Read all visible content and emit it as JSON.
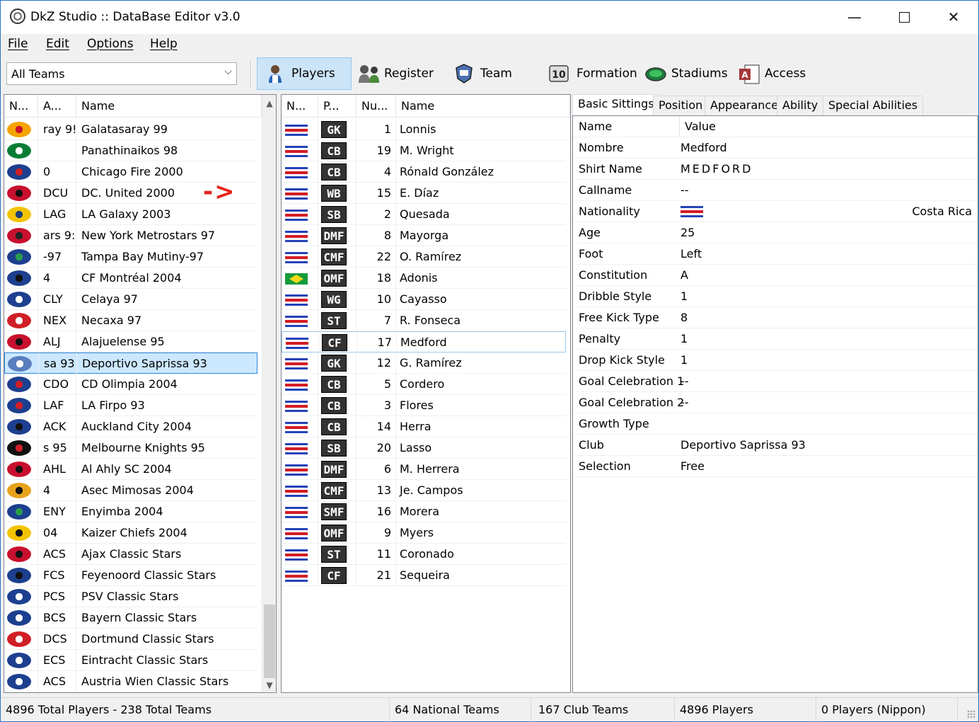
{
  "window": {
    "title": "DkZ Studio :: DataBase Editor v3.0"
  },
  "menu": [
    "File",
    "Edit",
    "Options",
    "Help"
  ],
  "toolbar": {
    "team_filter": "All Teams",
    "buttons": [
      {
        "label": "Players",
        "icon": "player-icon",
        "active": true
      },
      {
        "label": "Register",
        "icon": "register-icon",
        "active": false
      },
      {
        "label": "Team",
        "icon": "team-icon",
        "active": false
      },
      {
        "label": "Formation",
        "icon": "formation-icon",
        "active": false
      },
      {
        "label": "Stadiums",
        "icon": "stadium-icon",
        "active": false
      },
      {
        "label": "Access",
        "icon": "access-icon",
        "active": false
      }
    ]
  },
  "teams": {
    "columns": [
      "N...",
      "A...",
      "Name"
    ],
    "rows": [
      {
        "abbr": "ray 9!",
        "name": "Galatasaray 99",
        "colors": [
          "#f5a300",
          "#c8102e"
        ]
      },
      {
        "abbr": "",
        "name": "Panathinaikos 98",
        "colors": [
          "#0a7d35",
          "#ffffff"
        ]
      },
      {
        "abbr": "0",
        "name": "Chicago Fire 2000",
        "colors": [
          "#1d3f8f",
          "#d01f26"
        ]
      },
      {
        "abbr": "DCU",
        "name": "DC. United 2000",
        "colors": [
          "#c8102e",
          "#111111"
        ]
      },
      {
        "abbr": "LAG",
        "name": "LA Galaxy 2003",
        "colors": [
          "#f3c300",
          "#1a3d7c"
        ]
      },
      {
        "abbr": "ars 9:",
        "name": "New York Metrostars 97",
        "colors": [
          "#c8102e",
          "#222222"
        ]
      },
      {
        "abbr": "-97",
        "name": "Tampa Bay Mutiny-97",
        "colors": [
          "#1d3f8f",
          "#2a9d4c"
        ]
      },
      {
        "abbr": "4",
        "name": "CF Montréal 2004",
        "colors": [
          "#1d3f8f",
          "#111111"
        ]
      },
      {
        "abbr": "CLY",
        "name": "Celaya 97",
        "colors": [
          "#1d3f8f",
          "#ffffff"
        ]
      },
      {
        "abbr": "NEX",
        "name": "Necaxa 97",
        "colors": [
          "#d01f26",
          "#ffffff"
        ]
      },
      {
        "abbr": "ALJ",
        "name": "Alajuelense 95",
        "colors": [
          "#c8102e",
          "#111111"
        ]
      },
      {
        "abbr": "sa 93",
        "name": "Deportivo Saprissa 93",
        "colors": [
          "#5a7fbf",
          "#ffffff"
        ]
      },
      {
        "abbr": "CDO",
        "name": "CD Olimpia 2004",
        "colors": [
          "#1d3f8f",
          "#d01f26"
        ]
      },
      {
        "abbr": "LAF",
        "name": "LA Firpo 93",
        "colors": [
          "#1d3f8f",
          "#d01f26"
        ]
      },
      {
        "abbr": "ACK",
        "name": "Auckland City 2004",
        "colors": [
          "#1d3f8f",
          "#111111"
        ]
      },
      {
        "abbr": "s 95",
        "name": "Melbourne Knights 95",
        "colors": [
          "#111111",
          "#d01f26"
        ]
      },
      {
        "abbr": "AHL",
        "name": "Al Ahly SC 2004",
        "colors": [
          "#c8102e",
          "#111111"
        ]
      },
      {
        "abbr": "4",
        "name": "Asec Mimosas 2004",
        "colors": [
          "#e7a21b",
          "#111111"
        ]
      },
      {
        "abbr": "ENY",
        "name": "Enyimba 2004",
        "colors": [
          "#1d3f8f",
          "#2a9d4c"
        ]
      },
      {
        "abbr": "04",
        "name": "Kaizer Chiefs 2004",
        "colors": [
          "#f3c300",
          "#111111"
        ]
      },
      {
        "abbr": "ACS",
        "name": "Ajax Classic Stars",
        "colors": [
          "#c8102e",
          "#111111"
        ]
      },
      {
        "abbr": "FCS",
        "name": "Feyenoord Classic Stars",
        "colors": [
          "#1d3f8f",
          "#111111"
        ]
      },
      {
        "abbr": "PCS",
        "name": "PSV Classic Stars",
        "colors": [
          "#1d3f8f",
          "#ffffff"
        ]
      },
      {
        "abbr": "BCS",
        "name": "Bayern Classic Stars",
        "colors": [
          "#1d3f8f",
          "#ffffff"
        ]
      },
      {
        "abbr": "DCS",
        "name": "Dortmund Classic Stars",
        "colors": [
          "#d01f26",
          "#ffffff"
        ]
      },
      {
        "abbr": "ECS",
        "name": "Eintracht Classic Stars",
        "colors": [
          "#1d3f8f",
          "#ffffff"
        ]
      },
      {
        "abbr": "ACS",
        "name": "Austria Wien Classic Stars",
        "colors": [
          "#1d3f8f",
          "#ffffff"
        ]
      }
    ],
    "selected_index": 11
  },
  "players": {
    "columns": [
      "N...",
      "P...",
      "Nu...",
      "Name"
    ],
    "rows": [
      {
        "flag": "cr",
        "pos": "GK",
        "num": "1",
        "name": "Lonnis"
      },
      {
        "flag": "cr",
        "pos": "CB",
        "num": "19",
        "name": "M. Wright"
      },
      {
        "flag": "cr",
        "pos": "CB",
        "num": "4",
        "name": "Rónald González"
      },
      {
        "flag": "cr",
        "pos": "WB",
        "num": "15",
        "name": "E. Díaz"
      },
      {
        "flag": "cr",
        "pos": "SB",
        "num": "2",
        "name": "Quesada"
      },
      {
        "flag": "cr",
        "pos": "DMF",
        "num": "8",
        "name": "Mayorga"
      },
      {
        "flag": "cr",
        "pos": "CMF",
        "num": "22",
        "name": "O. Ramírez"
      },
      {
        "flag": "br",
        "pos": "OMF",
        "num": "18",
        "name": "Adonis"
      },
      {
        "flag": "cr",
        "pos": "WG",
        "num": "10",
        "name": "Cayasso"
      },
      {
        "flag": "cr",
        "pos": "ST",
        "num": "7",
        "name": "R. Fonseca"
      },
      {
        "flag": "cr",
        "pos": "CF",
        "num": "17",
        "name": "Medford"
      },
      {
        "flag": "cr",
        "pos": "GK",
        "num": "12",
        "name": "G. Ramírez"
      },
      {
        "flag": "cr",
        "pos": "CB",
        "num": "5",
        "name": "Cordero"
      },
      {
        "flag": "cr",
        "pos": "CB",
        "num": "3",
        "name": "Flores"
      },
      {
        "flag": "cr",
        "pos": "CB",
        "num": "14",
        "name": "Herra"
      },
      {
        "flag": "cr",
        "pos": "SB",
        "num": "20",
        "name": "Lasso"
      },
      {
        "flag": "cr",
        "pos": "DMF",
        "num": "6",
        "name": "M. Herrera"
      },
      {
        "flag": "cr",
        "pos": "CMF",
        "num": "13",
        "name": "Je. Campos"
      },
      {
        "flag": "cr",
        "pos": "SMF",
        "num": "16",
        "name": "Morera"
      },
      {
        "flag": "cr",
        "pos": "OMF",
        "num": "9",
        "name": "Myers"
      },
      {
        "flag": "cr",
        "pos": "ST",
        "num": "11",
        "name": "Coronado"
      },
      {
        "flag": "cr",
        "pos": "CF",
        "num": "21",
        "name": "Sequeira"
      }
    ],
    "focused_index": 10
  },
  "details": {
    "tabs": [
      "Basic Sittings",
      "Position",
      "Appearance",
      "Ability",
      "Special Abilities"
    ],
    "header": {
      "name": "Name",
      "value": "Value"
    },
    "props": [
      {
        "name": "Nombre",
        "value": "Medford"
      },
      {
        "name": "Shirt Name",
        "value": "MEDFORD"
      },
      {
        "name": "Callname",
        "value": "--"
      },
      {
        "name": "Nationality",
        "value": "Costa Rica",
        "flag": "cr"
      },
      {
        "name": "Age",
        "value": "25"
      },
      {
        "name": "Foot",
        "value": "Left"
      },
      {
        "name": "Constitution",
        "value": "A"
      },
      {
        "name": "Dribble Style",
        "value": "1"
      },
      {
        "name": "Free Kick Type",
        "value": "8"
      },
      {
        "name": "Penalty",
        "value": "1"
      },
      {
        "name": "Drop Kick Style",
        "value": "1"
      },
      {
        "name": "Goal Celebration 1",
        "value": "--"
      },
      {
        "name": "Goal Celebration 2",
        "value": "--"
      },
      {
        "name": "Growth Type",
        "value": ""
      },
      {
        "name": "Club",
        "value": "Deportivo Saprissa 93"
      },
      {
        "name": "Selection",
        "value": "Free"
      }
    ]
  },
  "annotation": "->",
  "status": {
    "totals": "4896 Total Players  -  238 Total Teams",
    "national": "64 National Teams",
    "club": "167 Club Teams",
    "players": "4896 Players",
    "nippon": "0 Players (Nippon)"
  }
}
